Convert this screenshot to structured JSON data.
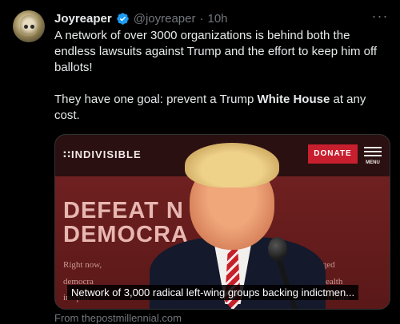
{
  "author": {
    "display_name": "Joyreaper",
    "handle": "@joyreaper",
    "separator": "·",
    "time": "10h",
    "verified": true,
    "verified_color": "#1d9bf0"
  },
  "more_label": "···",
  "tweet": {
    "paragraph1": "A network  of over 3000 organizations is behind both the endless lawsuits against Trump and the effort to keep him off ballots!",
    "paragraph2_before": "They have one  goal: prevent a Trump ",
    "paragraph2_bold": "White House",
    "paragraph2_after": " at any cost."
  },
  "media": {
    "site_logo": "∷INDIVISIBLE",
    "donate_label": "DONATE",
    "menu_label": "MENU",
    "headline_line1": "DEFEAT N    SAVE",
    "headline_line2": "DEMOCRA",
    "body_line1": "Right now,",
    "body_line1_right": "of a rigged",
    "body_line2": "democra",
    "body_line2_right": "wealth",
    "body_line3": "inequal",
    "body_line3_right": "climate",
    "caption": "Network of 3,000 radical left-wing groups backing indictmen..."
  },
  "source": "From thepostmillennial.com",
  "colors": {
    "background": "#000000",
    "text": "#e7e9ea",
    "muted": "#71767b",
    "donate": "#c81f2e"
  }
}
